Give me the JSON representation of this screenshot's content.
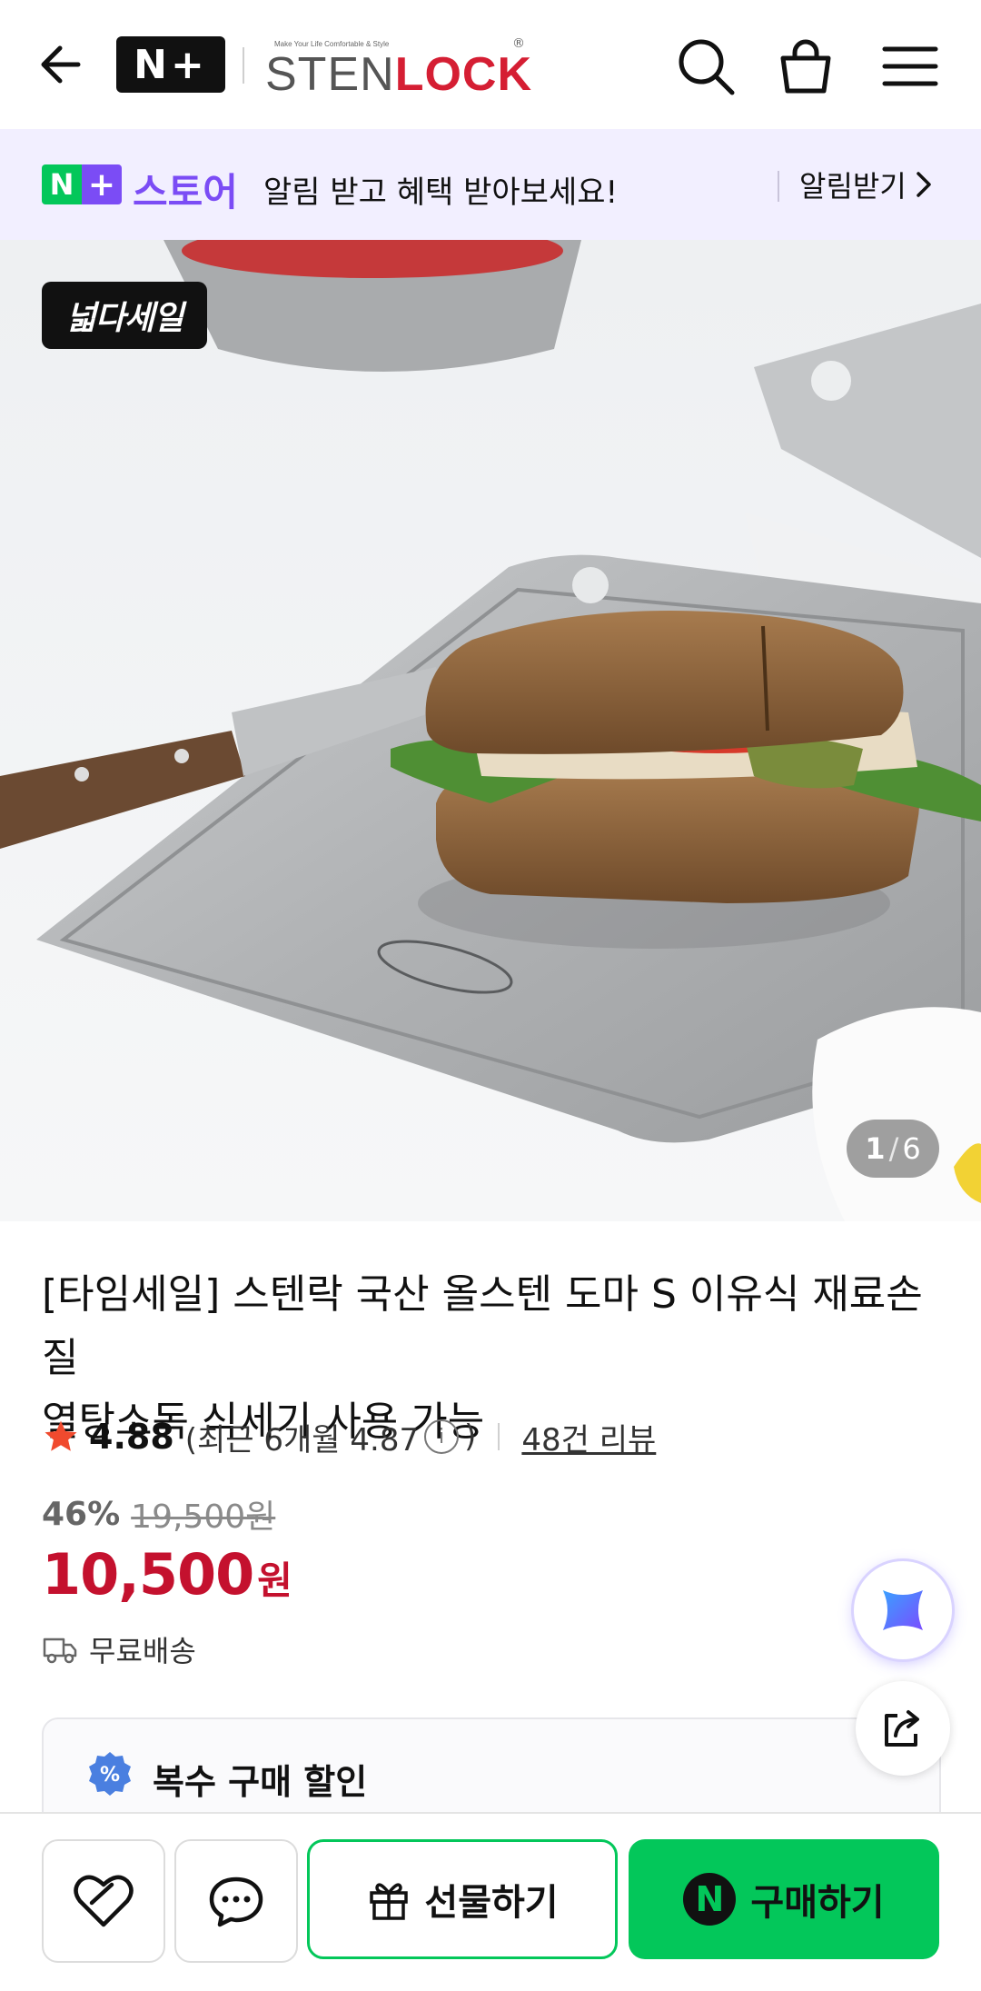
{
  "header": {
    "np_logo": "N+",
    "brand_tagline": "Make Your Life Comfortable & Style",
    "brand_sten": "STEN",
    "brand_lock": "LOCK",
    "brand_reg": "®"
  },
  "banner": {
    "store_n": "N",
    "store_plus": "+",
    "store_word": "스토어",
    "message": "알림 받고 혜택 받아보세요!",
    "alarm_label": "알림받기"
  },
  "gallery": {
    "sale_badge": "넓다세일",
    "current": "1",
    "total": "6",
    "separator": "/"
  },
  "product": {
    "title_line1": "[타임세일] 스텐락 국산 올스텐 도마 S 이유식 재료손질",
    "title_line2": "열탕소독 식세기 사용 가능",
    "rating": "4.88",
    "recent_rating": "(최근 6개월 4.87",
    "recent_close": ")",
    "review_count": "48건 리뷰",
    "discount_pct": "46%",
    "original_price": "19,500원",
    "price": "10,500",
    "price_unit": "원",
    "shipping": "무료배송"
  },
  "promo": {
    "icon_glyph": "%",
    "title": "복수 구매 할인"
  },
  "bottom": {
    "gift_label": "선물하기",
    "buy_label": "구매하기",
    "buy_n": "N"
  },
  "colors": {
    "naver_green": "#03c75a",
    "plus_purple": "#7b4cf5",
    "price_red": "#c4112e",
    "brand_red": "#d51e33"
  }
}
